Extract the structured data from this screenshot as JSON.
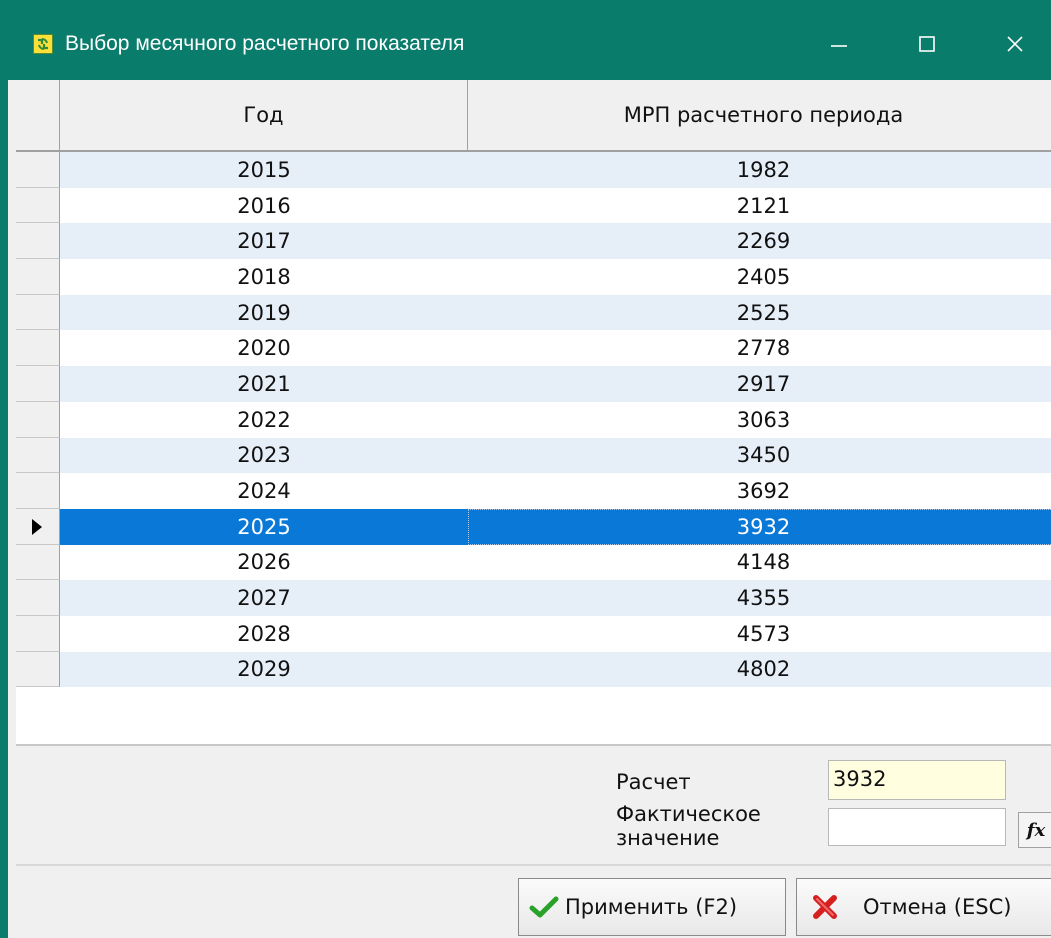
{
  "window": {
    "title": "Выбор месячного расчетного показателя",
    "title_color": "#0a7c6b"
  },
  "grid": {
    "headers": {
      "year": "Год",
      "mrp": "МРП расчетного периода"
    },
    "selected_color": "#0a78d7",
    "alt_row_color": "#e6eef8",
    "rows": [
      {
        "year": "2015",
        "mrp": "1982"
      },
      {
        "year": "2016",
        "mrp": "2121"
      },
      {
        "year": "2017",
        "mrp": "2269"
      },
      {
        "year": "2018",
        "mrp": "2405"
      },
      {
        "year": "2019",
        "mrp": "2525"
      },
      {
        "year": "2020",
        "mrp": "2778"
      },
      {
        "year": "2021",
        "mrp": "2917"
      },
      {
        "year": "2022",
        "mrp": "3063"
      },
      {
        "year": "2023",
        "mrp": "3450"
      },
      {
        "year": "2024",
        "mrp": "3692"
      },
      {
        "year": "2025",
        "mrp": "3932"
      },
      {
        "year": "2026",
        "mrp": "4148"
      },
      {
        "year": "2027",
        "mrp": "4355"
      },
      {
        "year": "2028",
        "mrp": "4573"
      },
      {
        "year": "2029",
        "mrp": "4802"
      }
    ],
    "selected_year": "2025"
  },
  "form": {
    "raschet_label": "Расчет",
    "raschet_value": "3932",
    "fact_label": "Фактическое значение",
    "fact_value": "",
    "fx_label": "fx"
  },
  "buttons": {
    "apply_label": "Применить (F2)",
    "cancel_label": "Отмена (ESC)"
  },
  "icons": {
    "app": "app-icon",
    "minimize": "minimize-icon",
    "maximize": "maximize-icon",
    "close": "close-icon",
    "row_pointer": "row-pointer-icon",
    "apply": "checkmark-icon",
    "cancel": "red-x-icon"
  }
}
